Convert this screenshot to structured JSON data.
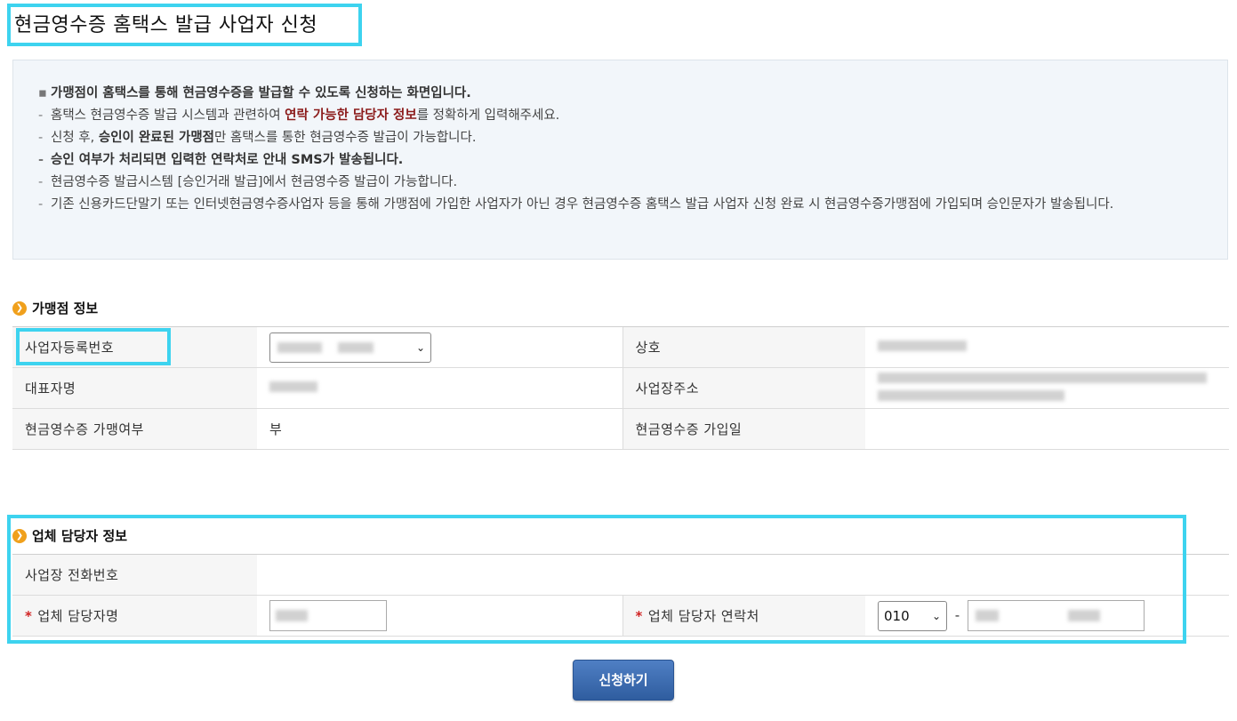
{
  "page": {
    "title": "현금영수증 홈택스 발급 사업자 신청"
  },
  "info": {
    "bullet_marker": "▪",
    "dash_marker": "-",
    "line1": "가맹점이 홈택스를 통해 현금영수증을 발급할 수 있도록 신청하는 화면입니다.",
    "line2_pre": "홈택스 현금영수증 발급 시스템과 관련하여 ",
    "line2_em": "연락 가능한 담당자 정보",
    "line2_post": "를 정확하게 입력해주세요.",
    "line3_pre": "신청 후, ",
    "line3_em": "승인이 완료된 가맹점",
    "line3_post": "만 홈택스를 통한 현금영수증 발급이 가능합니다.",
    "line4": "승인 여부가 처리되면 입력한 연락처로 안내 SMS가 발송됩니다.",
    "line5": "현금영수증 발급시스템 [승인거래 발급]에서 현금영수증 발급이 가능합니다.",
    "line6": "기존 신용카드단말기 또는 인터넷현금영수증사업자 등을 통해 가맹점에 가입한 사업자가 아닌 경우 현금영수증 홈택스 발급 사업자 신청 완료 시 현금영수증가맹점에 가입되며 승인문자가 발송됩니다."
  },
  "merchant": {
    "section_title": "가맹점 정보",
    "labels": {
      "business_no": "사업자등록번호",
      "company": "상호",
      "representative": "대표자명",
      "address": "사업장주소",
      "joined": "현금영수증 가맹여부",
      "join_date": "현금영수증 가입일"
    },
    "values": {
      "joined": "부"
    }
  },
  "contact": {
    "section_title": "업체 담당자 정보",
    "required_mark": "*",
    "labels": {
      "phone": "사업장 전화번호",
      "name": "업체 담당자명",
      "mobile": "업체 담당자 연락처"
    },
    "mobile_prefix": "010",
    "separator": "-"
  },
  "actions": {
    "submit": "신청하기"
  },
  "colors": {
    "highlight": "#3dd3ef",
    "emphasis": "#8b1a1a",
    "button": "#3a68ad",
    "required": "#d12323"
  }
}
